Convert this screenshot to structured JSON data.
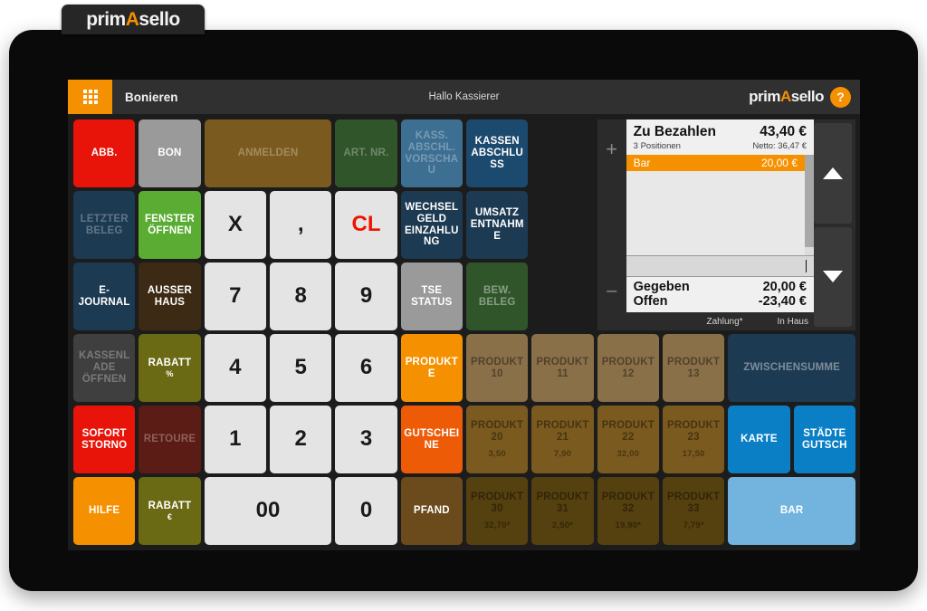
{
  "brand": {
    "part1": "prim",
    "mark": "A",
    "part2": "sello"
  },
  "appbar": {
    "apps_icon": "grid-apps-icon",
    "title": "Bonieren",
    "greeting": "Hallo Kassierer",
    "help_label": "?"
  },
  "panel": {
    "plus_label": "+",
    "minus_label": "–",
    "total_label": "Zu Bezahlen",
    "total_value": "43,40 €",
    "positions_label": "3 Positionen",
    "netto_label": "Netto: 36,47 €",
    "items": [
      {
        "name": "Bar",
        "amount": "20,00 €"
      }
    ],
    "given_label": "Gegeben",
    "given_value": "20,00 €",
    "open_label": "Offen",
    "open_value": "-23,40 €",
    "footer_center": "Zahlung*",
    "footer_right": "In Haus",
    "scroll_up_icon": "triangle-up-icon",
    "scroll_down_icon": "triangle-down-icon"
  },
  "colors": {
    "accent": "#f59100",
    "red": "#e8140a",
    "green": "#5aad32",
    "blue": "#0b7fc6",
    "lightblue": "#72b4dd",
    "brown": "#7a5a1e",
    "tan": "#8a7049",
    "darkbrown": "#6b4a1c",
    "olive": "#6b6a14",
    "darkblue": "#1c3a52",
    "steelblue": "#3d6f92",
    "darkgreen": "#31552b",
    "gray": "#9a9a9a",
    "darkgray": "#4a4a4a",
    "numpad": "#e4e4e4"
  },
  "buttons": [
    {
      "id": "abb",
      "label": "ABB.",
      "col": 1,
      "row": 1,
      "cspan": 1,
      "bg": "#e8140a",
      "style": "normal"
    },
    {
      "id": "bon",
      "label": "BON",
      "col": 2,
      "row": 1,
      "cspan": 1,
      "bg": "#9a9a9a",
      "style": "normal"
    },
    {
      "id": "anmelden",
      "label": "ANMELDEN",
      "col": 3,
      "row": 1,
      "cspan": 2,
      "bg": "#7a5a1e",
      "style": "dim"
    },
    {
      "id": "art-nr",
      "label": "ART. NR.",
      "col": 5,
      "row": 1,
      "cspan": 1,
      "bg": "#31552b",
      "style": "dim"
    },
    {
      "id": "kass-abschl-vorschau",
      "label": "KASS. ABSCHL. VORSCHAU",
      "col": 6,
      "row": 1,
      "cspan": 1,
      "bg": "#3d6f92",
      "style": "dim"
    },
    {
      "id": "kassenabschluss",
      "label": "KASSEN ABSCHLUSS",
      "col": 7,
      "row": 1,
      "cspan": 1,
      "bg": "#1c4a6e",
      "style": "normal"
    },
    {
      "id": "letzter-beleg",
      "label": "LETZTER BELEG",
      "col": 1,
      "row": 2,
      "cspan": 1,
      "bg": "#1c3a52",
      "style": "dim"
    },
    {
      "id": "fenster-oeffnen",
      "label": "FENSTER ÖFFNEN",
      "col": 2,
      "row": 2,
      "cspan": 1,
      "bg": "#5aad32",
      "style": "normal"
    },
    {
      "id": "multiply",
      "label": "X",
      "col": 3,
      "row": 2,
      "cspan": 1,
      "bg": "#e4e4e4",
      "style": "num"
    },
    {
      "id": "comma",
      "label": ",",
      "col": 4,
      "row": 2,
      "cspan": 1,
      "bg": "#e4e4e4",
      "style": "num"
    },
    {
      "id": "clear",
      "label": "CL",
      "col": 5,
      "row": 2,
      "cspan": 1,
      "bg": "#e4e4e4",
      "style": "cl"
    },
    {
      "id": "wechselgeld",
      "label": "WECHSELGELD EINZAHLUNG",
      "col": 6,
      "row": 2,
      "cspan": 1,
      "bg": "#1c3a52",
      "style": "normal"
    },
    {
      "id": "umsatzentnahme",
      "label": "UMSATZ ENTNAHME",
      "col": 7,
      "row": 2,
      "cspan": 1,
      "bg": "#1c3a52",
      "style": "normal"
    },
    {
      "id": "e-journal",
      "label": "E-JOURNAL",
      "col": 1,
      "row": 3,
      "cspan": 1,
      "bg": "#1c3a52",
      "style": "normal"
    },
    {
      "id": "ausser-haus",
      "label": "AUSSER HAUS",
      "col": 2,
      "row": 3,
      "cspan": 1,
      "bg": "#3d2a14",
      "style": "normal"
    },
    {
      "id": "num-7",
      "label": "7",
      "col": 3,
      "row": 3,
      "cspan": 1,
      "bg": "#e4e4e4",
      "style": "num"
    },
    {
      "id": "num-8",
      "label": "8",
      "col": 4,
      "row": 3,
      "cspan": 1,
      "bg": "#e4e4e4",
      "style": "num"
    },
    {
      "id": "num-9",
      "label": "9",
      "col": 5,
      "row": 3,
      "cspan": 1,
      "bg": "#e4e4e4",
      "style": "num"
    },
    {
      "id": "tse-status",
      "label": "TSE STATUS",
      "col": 6,
      "row": 3,
      "cspan": 1,
      "bg": "#9a9a9a",
      "style": "normal"
    },
    {
      "id": "bew-beleg",
      "label": "BEW. BELEG",
      "col": 7,
      "row": 3,
      "cspan": 1,
      "bg": "#31552b",
      "style": "dim2"
    },
    {
      "id": "kassenlade",
      "label": "KASSENLADE ÖFFNEN",
      "col": 1,
      "row": 4,
      "cspan": 1,
      "bg": "#3f3f3f",
      "style": "dim"
    },
    {
      "id": "rabatt-prozent",
      "label": "RABATT",
      "sub": "%",
      "col": 2,
      "row": 4,
      "cspan": 1,
      "bg": "#6b6a14",
      "style": "normal"
    },
    {
      "id": "num-4",
      "label": "4",
      "col": 3,
      "row": 4,
      "cspan": 1,
      "bg": "#e4e4e4",
      "style": "num"
    },
    {
      "id": "num-5",
      "label": "5",
      "col": 4,
      "row": 4,
      "cspan": 1,
      "bg": "#e4e4e4",
      "style": "num"
    },
    {
      "id": "num-6",
      "label": "6",
      "col": 5,
      "row": 4,
      "cspan": 1,
      "bg": "#e4e4e4",
      "style": "num"
    },
    {
      "id": "produkte",
      "label": "PRODUKTE",
      "col": 6,
      "row": 4,
      "cspan": 1,
      "bg": "#f59100",
      "style": "normal"
    },
    {
      "id": "produkt-10",
      "label": "PRODUKT 10",
      "col": 7,
      "row": 4,
      "cspan": 1,
      "bg": "#8a7049",
      "style": "dark-dim"
    },
    {
      "id": "produkt-11",
      "label": "PRODUKT 11",
      "col": 8,
      "row": 4,
      "cspan": 1,
      "bg": "#8a7049",
      "style": "dark-dim"
    },
    {
      "id": "produkt-12",
      "label": "PRODUKT 12",
      "col": 9,
      "row": 4,
      "cspan": 1,
      "bg": "#8a7049",
      "style": "dark-dim"
    },
    {
      "id": "produkt-13",
      "label": "PRODUKT 13",
      "col": 10,
      "row": 4,
      "cspan": 1,
      "bg": "#8a7049",
      "style": "dark-dim"
    },
    {
      "id": "zwischensumme",
      "label": "ZWISCHENSUMME",
      "col": 11,
      "row": 4,
      "cspan": 2,
      "bg": "#1c3a52",
      "style": "dim2"
    },
    {
      "id": "sofort-storno",
      "label": "SOFORT STORNO",
      "col": 1,
      "row": 5,
      "cspan": 1,
      "bg": "#e8140a",
      "style": "normal"
    },
    {
      "id": "retoure",
      "label": "RETOURE",
      "col": 2,
      "row": 5,
      "cspan": 1,
      "bg": "#5a1c14",
      "style": "dim"
    },
    {
      "id": "num-1",
      "label": "1",
      "col": 3,
      "row": 5,
      "cspan": 1,
      "bg": "#e4e4e4",
      "style": "num"
    },
    {
      "id": "num-2",
      "label": "2",
      "col": 4,
      "row": 5,
      "cspan": 1,
      "bg": "#e4e4e4",
      "style": "num"
    },
    {
      "id": "num-3",
      "label": "3",
      "col": 5,
      "row": 5,
      "cspan": 1,
      "bg": "#e4e4e4",
      "style": "num"
    },
    {
      "id": "gutscheine",
      "label": "GUTSCHEINE",
      "col": 6,
      "row": 5,
      "cspan": 1,
      "bg": "#ed5b06",
      "style": "normal"
    },
    {
      "id": "produkt-20",
      "label": "PRODUKT 20",
      "price": "3,50",
      "col": 7,
      "row": 5,
      "cspan": 1,
      "bg": "#7a5a1e",
      "style": "dark-dim"
    },
    {
      "id": "produkt-21",
      "label": "PRODUKT 21",
      "price": "7,90",
      "col": 8,
      "row": 5,
      "cspan": 1,
      "bg": "#7a5a1e",
      "style": "dark-dim"
    },
    {
      "id": "produkt-22",
      "label": "PRODUKT 22",
      "price": "32,00",
      "col": 9,
      "row": 5,
      "cspan": 1,
      "bg": "#7a5a1e",
      "style": "dark-dim"
    },
    {
      "id": "produkt-23",
      "label": "PRODUKT 23",
      "price": "17,50",
      "col": 10,
      "row": 5,
      "cspan": 1,
      "bg": "#7a5a1e",
      "style": "dark-dim"
    },
    {
      "id": "karte",
      "label": "KARTE",
      "col": 11,
      "row": 5,
      "cspan": 1,
      "bg": "#0b7fc6",
      "style": "normal"
    },
    {
      "id": "staedte-gutsch",
      "label": "STÄDTE GUTSCH",
      "col": 12,
      "row": 5,
      "cspan": 1,
      "bg": "#0b7fc6",
      "style": "normal"
    },
    {
      "id": "hilfe",
      "label": "HILFE",
      "col": 1,
      "row": 6,
      "cspan": 1,
      "bg": "#f59100",
      "style": "normal"
    },
    {
      "id": "rabatt-euro",
      "label": "RABATT",
      "sub": "€",
      "col": 2,
      "row": 6,
      "cspan": 1,
      "bg": "#6b6a14",
      "style": "normal"
    },
    {
      "id": "num-00",
      "label": "00",
      "col": 3,
      "row": 6,
      "cspan": 2,
      "bg": "#e4e4e4",
      "style": "num"
    },
    {
      "id": "num-0",
      "label": "0",
      "col": 5,
      "row": 6,
      "cspan": 1,
      "bg": "#e4e4e4",
      "style": "num"
    },
    {
      "id": "pfand",
      "label": "PFAND",
      "col": 6,
      "row": 6,
      "cspan": 1,
      "bg": "#6b4a1c",
      "style": "normal"
    },
    {
      "id": "produkt-30",
      "label": "PRODUKT 30",
      "price": "32,70*",
      "col": 7,
      "row": 6,
      "cspan": 1,
      "bg": "#55400f",
      "style": "dark-dim"
    },
    {
      "id": "produkt-31",
      "label": "PRODUKT 31",
      "price": "2,50*",
      "col": 8,
      "row": 6,
      "cspan": 1,
      "bg": "#55400f",
      "style": "dark-dim"
    },
    {
      "id": "produkt-32",
      "label": "PRODUKT 32",
      "price": "19,90*",
      "col": 9,
      "row": 6,
      "cspan": 1,
      "bg": "#55400f",
      "style": "dark-dim"
    },
    {
      "id": "produkt-33",
      "label": "PRODUKT 33",
      "price": "7,79*",
      "col": 10,
      "row": 6,
      "cspan": 1,
      "bg": "#55400f",
      "style": "dark-dim"
    },
    {
      "id": "bar",
      "label": "BAR",
      "col": 11,
      "row": 6,
      "cspan": 2,
      "bg": "#72b4dd",
      "style": "normal"
    }
  ]
}
